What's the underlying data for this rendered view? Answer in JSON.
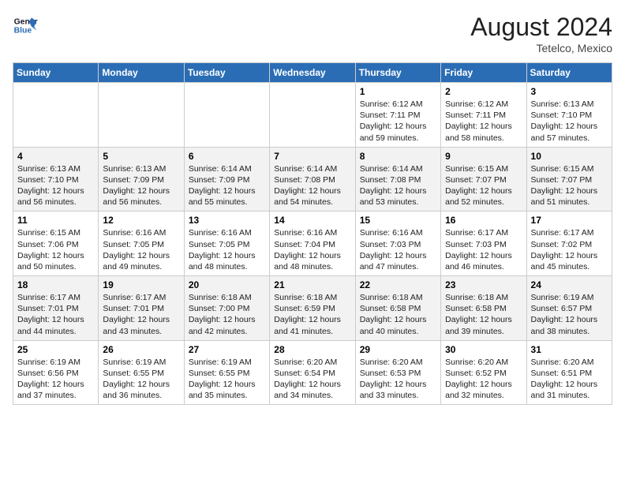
{
  "header": {
    "logo_line1": "General",
    "logo_line2": "Blue",
    "month_year": "August 2024",
    "location": "Tetelco, Mexico"
  },
  "weekdays": [
    "Sunday",
    "Monday",
    "Tuesday",
    "Wednesday",
    "Thursday",
    "Friday",
    "Saturday"
  ],
  "weeks": [
    [
      {
        "day": "",
        "info": ""
      },
      {
        "day": "",
        "info": ""
      },
      {
        "day": "",
        "info": ""
      },
      {
        "day": "",
        "info": ""
      },
      {
        "day": "1",
        "info": "Sunrise: 6:12 AM\nSunset: 7:11 PM\nDaylight: 12 hours\nand 59 minutes."
      },
      {
        "day": "2",
        "info": "Sunrise: 6:12 AM\nSunset: 7:11 PM\nDaylight: 12 hours\nand 58 minutes."
      },
      {
        "day": "3",
        "info": "Sunrise: 6:13 AM\nSunset: 7:10 PM\nDaylight: 12 hours\nand 57 minutes."
      }
    ],
    [
      {
        "day": "4",
        "info": "Sunrise: 6:13 AM\nSunset: 7:10 PM\nDaylight: 12 hours\nand 56 minutes."
      },
      {
        "day": "5",
        "info": "Sunrise: 6:13 AM\nSunset: 7:09 PM\nDaylight: 12 hours\nand 56 minutes."
      },
      {
        "day": "6",
        "info": "Sunrise: 6:14 AM\nSunset: 7:09 PM\nDaylight: 12 hours\nand 55 minutes."
      },
      {
        "day": "7",
        "info": "Sunrise: 6:14 AM\nSunset: 7:08 PM\nDaylight: 12 hours\nand 54 minutes."
      },
      {
        "day": "8",
        "info": "Sunrise: 6:14 AM\nSunset: 7:08 PM\nDaylight: 12 hours\nand 53 minutes."
      },
      {
        "day": "9",
        "info": "Sunrise: 6:15 AM\nSunset: 7:07 PM\nDaylight: 12 hours\nand 52 minutes."
      },
      {
        "day": "10",
        "info": "Sunrise: 6:15 AM\nSunset: 7:07 PM\nDaylight: 12 hours\nand 51 minutes."
      }
    ],
    [
      {
        "day": "11",
        "info": "Sunrise: 6:15 AM\nSunset: 7:06 PM\nDaylight: 12 hours\nand 50 minutes."
      },
      {
        "day": "12",
        "info": "Sunrise: 6:16 AM\nSunset: 7:05 PM\nDaylight: 12 hours\nand 49 minutes."
      },
      {
        "day": "13",
        "info": "Sunrise: 6:16 AM\nSunset: 7:05 PM\nDaylight: 12 hours\nand 48 minutes."
      },
      {
        "day": "14",
        "info": "Sunrise: 6:16 AM\nSunset: 7:04 PM\nDaylight: 12 hours\nand 48 minutes."
      },
      {
        "day": "15",
        "info": "Sunrise: 6:16 AM\nSunset: 7:03 PM\nDaylight: 12 hours\nand 47 minutes."
      },
      {
        "day": "16",
        "info": "Sunrise: 6:17 AM\nSunset: 7:03 PM\nDaylight: 12 hours\nand 46 minutes."
      },
      {
        "day": "17",
        "info": "Sunrise: 6:17 AM\nSunset: 7:02 PM\nDaylight: 12 hours\nand 45 minutes."
      }
    ],
    [
      {
        "day": "18",
        "info": "Sunrise: 6:17 AM\nSunset: 7:01 PM\nDaylight: 12 hours\nand 44 minutes."
      },
      {
        "day": "19",
        "info": "Sunrise: 6:17 AM\nSunset: 7:01 PM\nDaylight: 12 hours\nand 43 minutes."
      },
      {
        "day": "20",
        "info": "Sunrise: 6:18 AM\nSunset: 7:00 PM\nDaylight: 12 hours\nand 42 minutes."
      },
      {
        "day": "21",
        "info": "Sunrise: 6:18 AM\nSunset: 6:59 PM\nDaylight: 12 hours\nand 41 minutes."
      },
      {
        "day": "22",
        "info": "Sunrise: 6:18 AM\nSunset: 6:58 PM\nDaylight: 12 hours\nand 40 minutes."
      },
      {
        "day": "23",
        "info": "Sunrise: 6:18 AM\nSunset: 6:58 PM\nDaylight: 12 hours\nand 39 minutes."
      },
      {
        "day": "24",
        "info": "Sunrise: 6:19 AM\nSunset: 6:57 PM\nDaylight: 12 hours\nand 38 minutes."
      }
    ],
    [
      {
        "day": "25",
        "info": "Sunrise: 6:19 AM\nSunset: 6:56 PM\nDaylight: 12 hours\nand 37 minutes."
      },
      {
        "day": "26",
        "info": "Sunrise: 6:19 AM\nSunset: 6:55 PM\nDaylight: 12 hours\nand 36 minutes."
      },
      {
        "day": "27",
        "info": "Sunrise: 6:19 AM\nSunset: 6:55 PM\nDaylight: 12 hours\nand 35 minutes."
      },
      {
        "day": "28",
        "info": "Sunrise: 6:20 AM\nSunset: 6:54 PM\nDaylight: 12 hours\nand 34 minutes."
      },
      {
        "day": "29",
        "info": "Sunrise: 6:20 AM\nSunset: 6:53 PM\nDaylight: 12 hours\nand 33 minutes."
      },
      {
        "day": "30",
        "info": "Sunrise: 6:20 AM\nSunset: 6:52 PM\nDaylight: 12 hours\nand 32 minutes."
      },
      {
        "day": "31",
        "info": "Sunrise: 6:20 AM\nSunset: 6:51 PM\nDaylight: 12 hours\nand 31 minutes."
      }
    ]
  ]
}
